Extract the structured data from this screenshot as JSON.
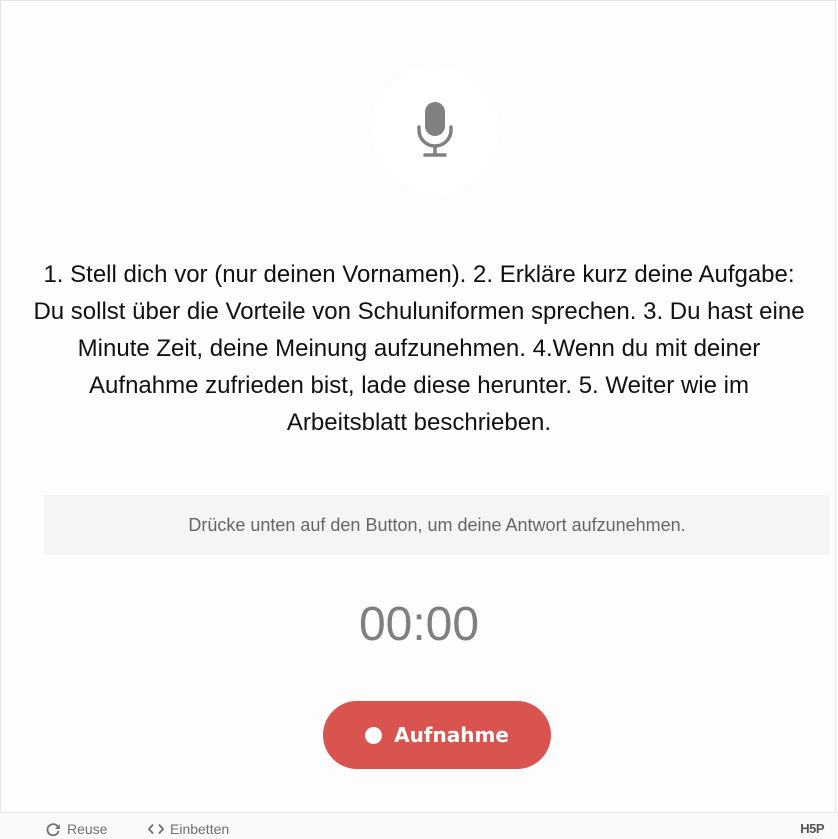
{
  "recorder": {
    "icon": "microphone-icon",
    "instructions": "1. Stell dich vor (nur deinen Vornamen). 2. Erkläre kurz deine Aufgabe: Du sollst über die Vorteile von Schuluniformen sprechen. 3. Du hast eine Minute Zeit, deine Meinung aufzunehmen. 4.Wenn du mit deiner Aufnahme zufrieden bist, lade diese herunter. 5. Weiter wie im Arbeitsblatt beschrieben.",
    "hint": "Drücke unten auf den Button, um deine Antwort aufzunehmen.",
    "timer": "00:00",
    "record_button_label": "Aufnahme"
  },
  "footer": {
    "reuse_label": "Reuse",
    "reuse_icon": "refresh-icon",
    "embed_label": "Einbetten",
    "embed_icon": "code-icon",
    "logo": "H5P"
  },
  "colors": {
    "record_button": "#d9534f",
    "timer_text": "#7f7f7f",
    "hint_background": "#f5f5f5",
    "microphone": "#808080"
  }
}
